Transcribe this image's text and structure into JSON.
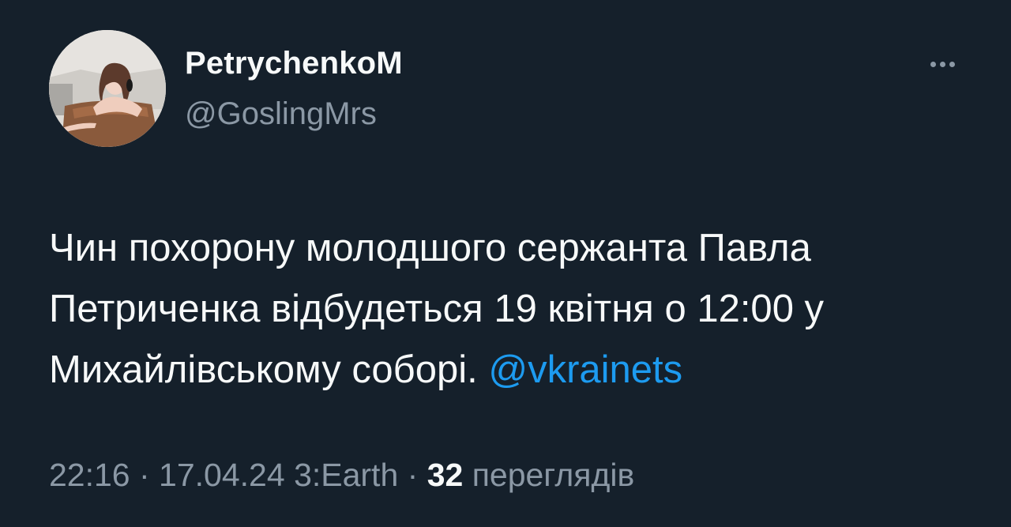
{
  "author": {
    "display_name": "PetrychenkoM",
    "handle": "@GoslingMrs"
  },
  "more_icon": "more-horizontal-icon",
  "tweet": {
    "line1": "Чин похорону молодшого сержанта Павла",
    "line2": "Петриченка відбудеться 19 квітня о 12:00 у",
    "line3": "Михайлівському соборі. ",
    "mention": "@vkrainets"
  },
  "meta": {
    "time": "22:16",
    "sep1": " · ",
    "date": "17.04.24",
    "space": " ",
    "source": "3:Earth",
    "sep2": " · ",
    "views_count": "32",
    "views_label": " переглядів"
  },
  "colors": {
    "background": "#15202b",
    "primary_text": "#f7f9f9",
    "secondary_text": "#8b98a5",
    "link": "#1d9bf0"
  }
}
